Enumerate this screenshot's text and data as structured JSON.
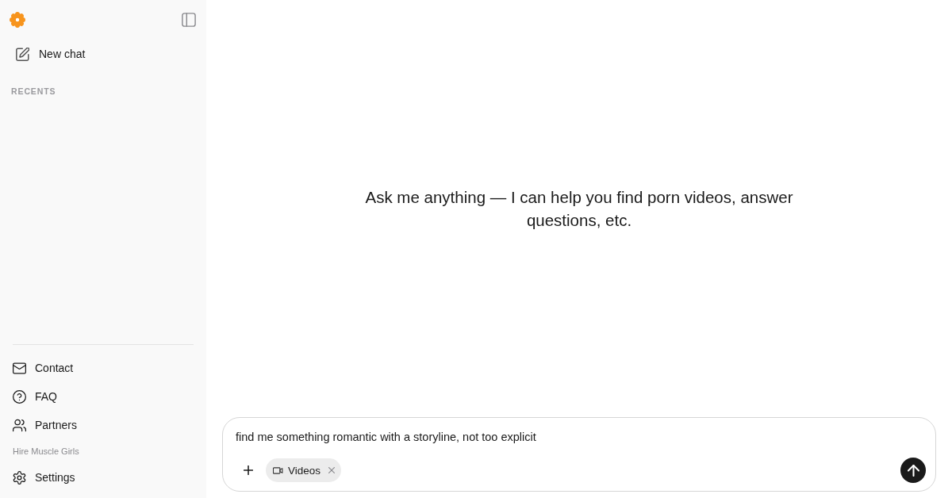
{
  "sidebar": {
    "new_chat": "New chat",
    "section_label": "RECENTS",
    "links": [
      "Contact",
      "FAQ",
      "Partners"
    ],
    "promo_link": "Hire Muscle Girls",
    "settings": "Settings"
  },
  "main": {
    "greeting": "Ask me anything — I can help you find porn videos, answer questions, etc."
  },
  "composer": {
    "value": "find me something romantic with a storyline, not too explicit",
    "chips": [
      {
        "label": "Videos"
      }
    ]
  }
}
